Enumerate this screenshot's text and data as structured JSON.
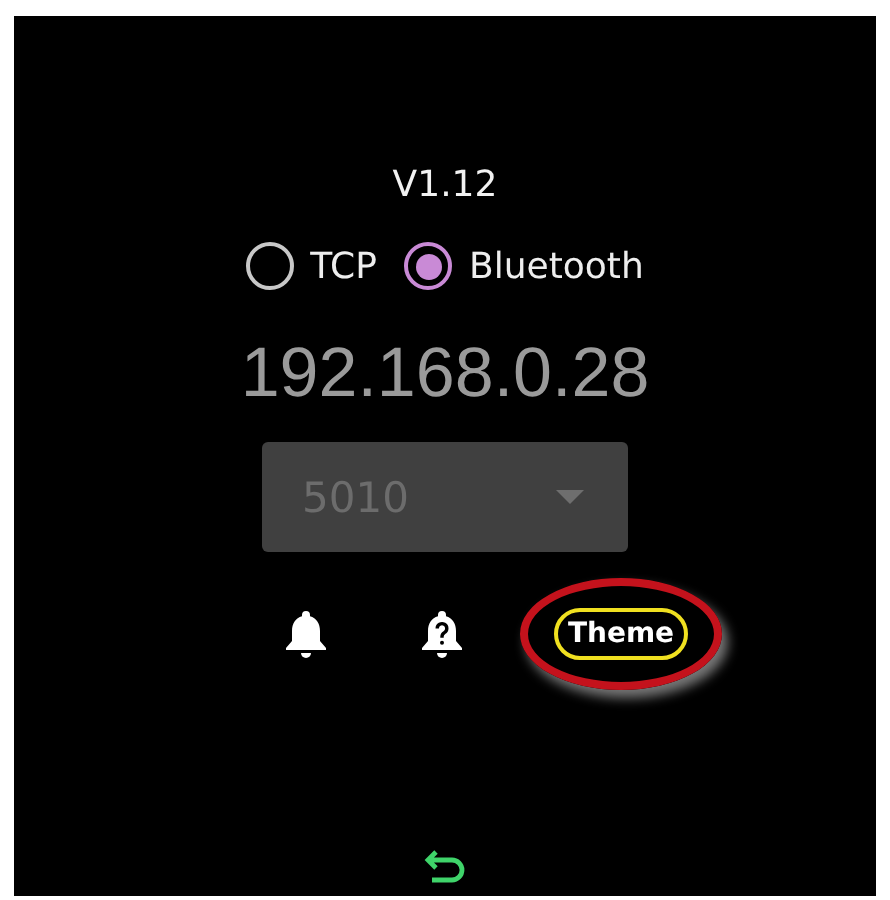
{
  "version": "V1.12",
  "connection": [
    {
      "label": "TCP",
      "selected": false
    },
    {
      "label": "Bluetooth",
      "selected": true
    }
  ],
  "ip_address": "192.168.0.28",
  "port_dropdown": {
    "value": "5010",
    "disabled": true
  },
  "theme_button": {
    "label": "Theme",
    "highlighted": true
  }
}
